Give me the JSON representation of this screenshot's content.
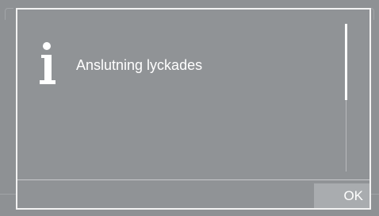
{
  "dialog": {
    "icon": "info-icon",
    "message": "Anslutning lyckades",
    "ok_label": "OK"
  },
  "colors": {
    "background": "#8e9194",
    "border": "#f2f2f2",
    "text": "#ffffff",
    "button_bg": "#a9acaf"
  }
}
